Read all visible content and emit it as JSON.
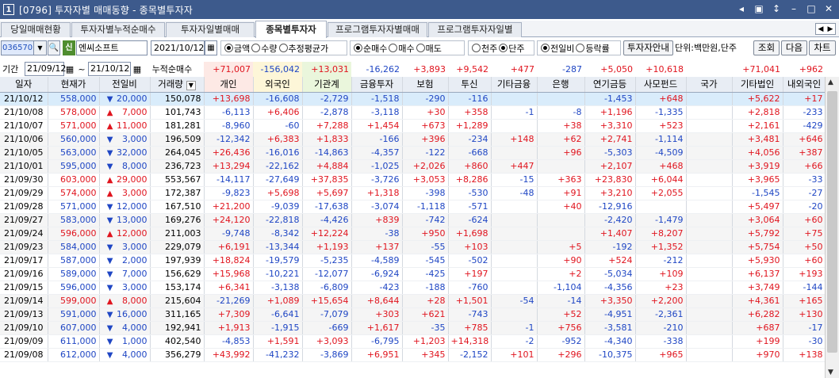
{
  "window": {
    "number": "1",
    "title": "[0796] 투자자별 매매동향 - 종목별투자자"
  },
  "tabs": [
    "당일매매현황",
    "투자자별누적순매수",
    "투자자일별매매",
    "종목별투자자",
    "프로그램투자자별매매",
    "프로그램투자자일별"
  ],
  "active_tab": 3,
  "controls": {
    "code": "036570",
    "sin": "신",
    "name": "엔씨소프트",
    "date": "2021/10/12",
    "group1": [
      "금액",
      "수량",
      "추정평균가"
    ],
    "group2": [
      "순매수",
      "매수",
      "매도"
    ],
    "group3": [
      "천주",
      "단주"
    ],
    "group4": [
      "전일비",
      "등락률"
    ],
    "investor_btn": "투자자안내",
    "unit": "단위:백만원,단주",
    "btn_query": "조회",
    "btn_next": "다음",
    "btn_chart": "차트"
  },
  "period": {
    "label": "기간",
    "from": "21/09/12",
    "to": "21/10/12",
    "cum_label": "누적순매수"
  },
  "sums": [
    "+71,007",
    "-156,042",
    "+13,031",
    "-16,262",
    "+3,893",
    "+9,542",
    "+477",
    "-287",
    "+5,050",
    "+10,618",
    "",
    "+71,041",
    "+962"
  ],
  "headers": [
    "일자",
    "현재가",
    "전일비",
    "거래량",
    "개인",
    "외국인",
    "기관계",
    "금융투자",
    "보험",
    "투신",
    "기타금융",
    "은행",
    "연기금등",
    "사모펀드",
    "국가",
    "기타법인",
    "내외국인"
  ],
  "rows": [
    [
      "21/10/12",
      "558,000",
      "dn",
      "20,000",
      "150,078",
      "+13,698",
      "-16,608",
      "-2,729",
      "-1,518",
      "-290",
      "-116",
      "",
      "",
      "-1,453",
      "+648",
      "",
      "+5,622",
      "+17"
    ],
    [
      "21/10/08",
      "578,000",
      "up",
      "7,000",
      "101,743",
      "-6,113",
      "+6,406",
      "-2,878",
      "-3,118",
      "+30",
      "+358",
      "-1",
      "-8",
      "+1,196",
      "-1,335",
      "",
      "+2,818",
      "-233"
    ],
    [
      "21/10/07",
      "571,000",
      "up",
      "11,000",
      "181,281",
      "-8,960",
      "-60",
      "+7,288",
      "+1,454",
      "+673",
      "+1,289",
      "",
      "+38",
      "+3,310",
      "+523",
      "",
      "+2,161",
      "-429"
    ],
    [
      "21/10/06",
      "560,000",
      "dn",
      "3,000",
      "196,509",
      "-12,342",
      "+6,383",
      "+1,833",
      "-166",
      "+396",
      "-234",
      "+148",
      "+62",
      "+2,741",
      "-1,114",
      "",
      "+3,481",
      "+646"
    ],
    [
      "21/10/05",
      "563,000",
      "dn",
      "32,000",
      "264,045",
      "+26,436",
      "-16,016",
      "-14,863",
      "-4,357",
      "-122",
      "-668",
      "",
      "+96",
      "-5,303",
      "-4,509",
      "",
      "+4,056",
      "+387"
    ],
    [
      "21/10/01",
      "595,000",
      "dn",
      "8,000",
      "236,723",
      "+13,294",
      "-22,162",
      "+4,884",
      "-1,025",
      "+2,026",
      "+860",
      "+447",
      "",
      "+2,107",
      "+468",
      "",
      "+3,919",
      "+66"
    ],
    [
      "21/09/30",
      "603,000",
      "up",
      "29,000",
      "553,567",
      "-14,117",
      "-27,649",
      "+37,835",
      "-3,726",
      "+3,053",
      "+8,286",
      "-15",
      "+363",
      "+23,830",
      "+6,044",
      "",
      "+3,965",
      "-33"
    ],
    [
      "21/09/29",
      "574,000",
      "up",
      "3,000",
      "172,387",
      "-9,823",
      "+5,698",
      "+5,697",
      "+1,318",
      "-398",
      "-530",
      "-48",
      "+91",
      "+3,210",
      "+2,055",
      "",
      "-1,545",
      "-27"
    ],
    [
      "21/09/28",
      "571,000",
      "dn",
      "12,000",
      "167,510",
      "+21,200",
      "-9,039",
      "-17,638",
      "-3,074",
      "-1,118",
      "-571",
      "",
      "+40",
      "-12,916",
      "",
      "",
      "+5,497",
      "-20"
    ],
    [
      "21/09/27",
      "583,000",
      "dn",
      "13,000",
      "169,276",
      "+24,120",
      "-22,818",
      "-4,426",
      "+839",
      "-742",
      "-624",
      "",
      "",
      "-2,420",
      "-1,479",
      "",
      "+3,064",
      "+60"
    ],
    [
      "21/09/24",
      "596,000",
      "up",
      "12,000",
      "211,003",
      "-9,748",
      "-8,342",
      "+12,224",
      "-38",
      "+950",
      "+1,698",
      "",
      "",
      "+1,407",
      "+8,207",
      "",
      "+5,792",
      "+75"
    ],
    [
      "21/09/23",
      "584,000",
      "dn",
      "3,000",
      "229,079",
      "+6,191",
      "-13,344",
      "+1,193",
      "+137",
      "-55",
      "+103",
      "",
      "+5",
      "-192",
      "+1,352",
      "",
      "+5,754",
      "+50"
    ],
    [
      "21/09/17",
      "587,000",
      "dn",
      "2,000",
      "197,939",
      "+18,824",
      "-19,579",
      "-5,235",
      "-4,589",
      "-545",
      "-502",
      "",
      "+90",
      "+524",
      "-212",
      "",
      "+5,930",
      "+60"
    ],
    [
      "21/09/16",
      "589,000",
      "dn",
      "7,000",
      "156,629",
      "+15,968",
      "-10,221",
      "-12,077",
      "-6,924",
      "-425",
      "+197",
      "",
      "+2",
      "-5,034",
      "+109",
      "",
      "+6,137",
      "+193"
    ],
    [
      "21/09/15",
      "596,000",
      "dn",
      "3,000",
      "153,174",
      "+6,341",
      "-3,138",
      "-6,809",
      "-423",
      "-188",
      "-760",
      "",
      "-1,104",
      "-4,356",
      "+23",
      "",
      "+3,749",
      "-144"
    ],
    [
      "21/09/14",
      "599,000",
      "up",
      "8,000",
      "215,604",
      "-21,269",
      "+1,089",
      "+15,654",
      "+8,644",
      "+28",
      "+1,501",
      "-54",
      "-14",
      "+3,350",
      "+2,200",
      "",
      "+4,361",
      "+165"
    ],
    [
      "21/09/13",
      "591,000",
      "dn",
      "16,000",
      "311,165",
      "+7,309",
      "-6,641",
      "-7,079",
      "+303",
      "+621",
      "-743",
      "",
      "+52",
      "-4,951",
      "-2,361",
      "",
      "+6,282",
      "+130"
    ],
    [
      "21/09/10",
      "607,000",
      "dn",
      "4,000",
      "192,941",
      "+1,913",
      "-1,915",
      "-669",
      "+1,617",
      "-35",
      "+785",
      "-1",
      "+756",
      "-3,581",
      "-210",
      "",
      "+687",
      "-17"
    ],
    [
      "21/09/09",
      "611,000",
      "dn",
      "1,000",
      "402,540",
      "-4,853",
      "+1,591",
      "+3,093",
      "-6,795",
      "+1,203",
      "+14,318",
      "-2",
      "-952",
      "-4,340",
      "-338",
      "",
      "+199",
      "-30"
    ],
    [
      "21/09/08",
      "612,000",
      "dn",
      "4,000",
      "356,279",
      "+43,992",
      "-41,232",
      "-3,869",
      "+6,951",
      "+345",
      "-2,152",
      "+101",
      "+296",
      "-10,375",
      "+965",
      "",
      "+970",
      "+138"
    ]
  ]
}
